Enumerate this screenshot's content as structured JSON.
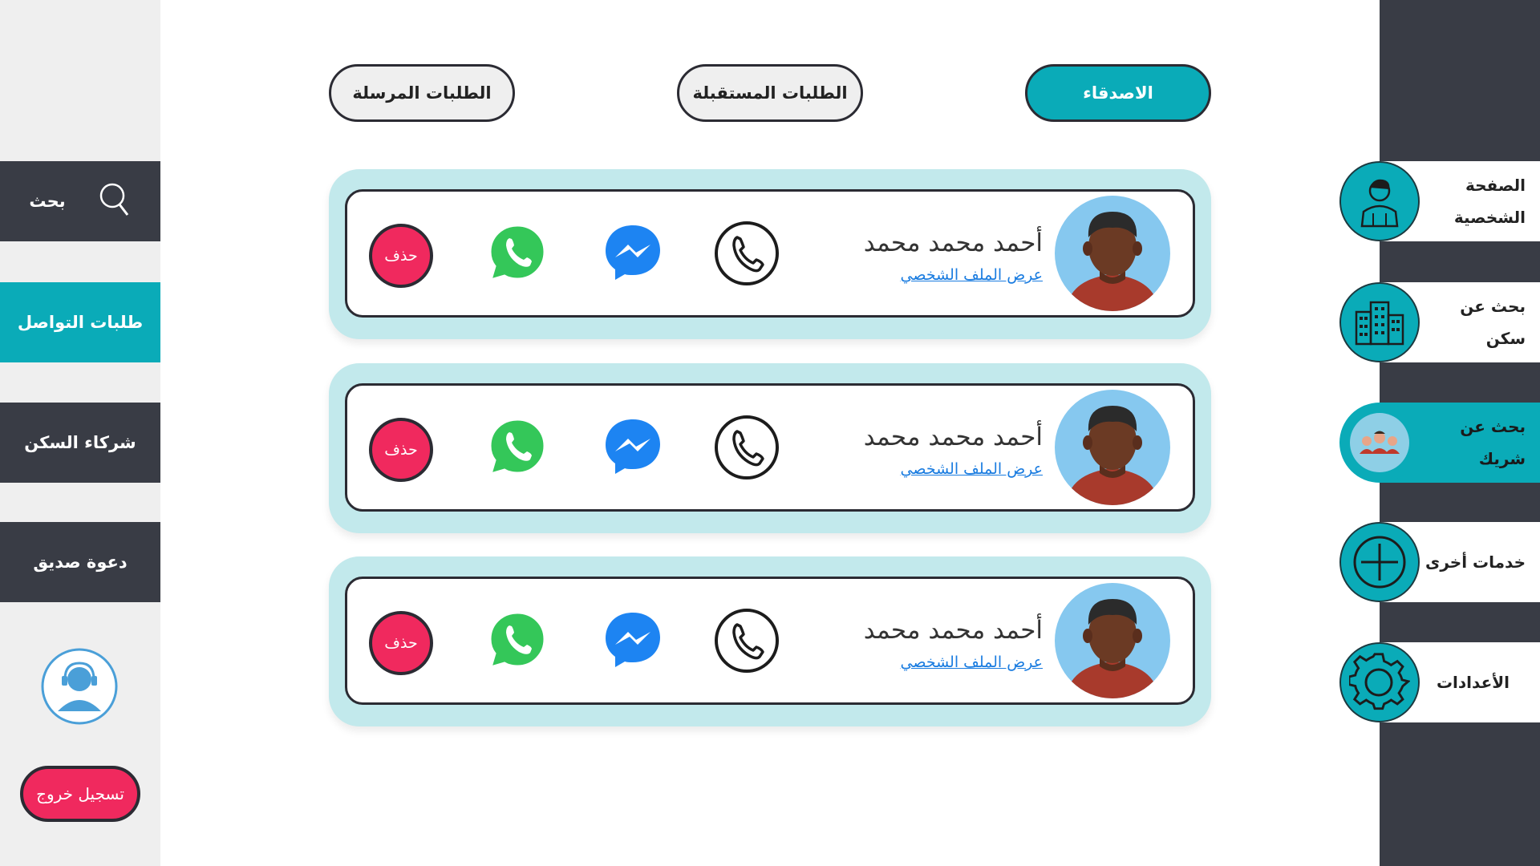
{
  "tabs": {
    "friends": "الاصدقاء",
    "incoming": "الطلبات المستقبلة",
    "sent": "الطلبات المرسلة"
  },
  "left_nav": {
    "search": "بحث",
    "contact_requests": "طلبات التواصل",
    "housing_partners": "شركاء السكن",
    "invite_friend": "دعوة صديق",
    "logout": "تسجيل خروج"
  },
  "right_nav": {
    "profile": "الصفحة الشخصية",
    "find_housing": "بحث عن سكن",
    "find_partner": "بحث عن شريك",
    "other_services": "خدمات أخرى",
    "settings": "الأعدادات"
  },
  "contacts": [
    {
      "name": "أحمد محمد محمد",
      "profile_link": "عرض الملف الشخصي",
      "delete": "حذف"
    },
    {
      "name": "أحمد محمد محمد",
      "profile_link": "عرض الملف الشخصي",
      "delete": "حذف"
    },
    {
      "name": "أحمد محمد محمد",
      "profile_link": "عرض الملف الشخصي",
      "delete": "حذف"
    }
  ],
  "colors": {
    "teal": "#0aabb8",
    "dark": "#393c45",
    "delete_red": "#f0295e",
    "card_bg": "#c2e9ec",
    "link_blue": "#1a7ce0"
  },
  "icons": [
    "search-icon",
    "support-agent-icon",
    "user-icon",
    "building-icon",
    "people-icon",
    "plus-icon",
    "gear-icon",
    "phone-icon",
    "messenger-icon",
    "whatsapp-icon"
  ]
}
